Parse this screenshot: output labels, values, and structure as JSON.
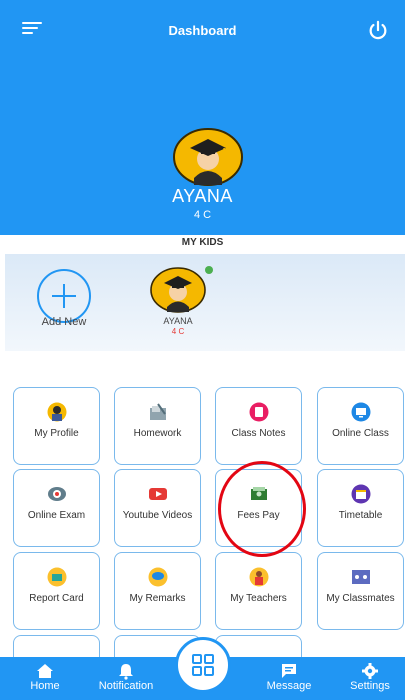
{
  "header": {
    "title": "Dashboard",
    "menu_icon": "menu-icon",
    "power_icon": "power-icon"
  },
  "current_kid": {
    "name": "AYANA",
    "class": "4 C"
  },
  "my_kids_label": "MY KIDS",
  "kids_panel": {
    "add_new_label": "Add New",
    "kids": [
      {
        "name": "AYANA",
        "class": "4 C",
        "online": true
      }
    ]
  },
  "tiles": [
    {
      "label": "My Profile",
      "icon": "profile-icon"
    },
    {
      "label": "Homework",
      "icon": "homework-icon"
    },
    {
      "label": "Class Notes",
      "icon": "class-notes-icon"
    },
    {
      "label": "Online Class",
      "icon": "online-class-icon"
    },
    {
      "label": "Online Exam",
      "icon": "online-exam-icon"
    },
    {
      "label": "Youtube Videos",
      "icon": "youtube-icon"
    },
    {
      "label": "Fees Pay",
      "icon": "fees-pay-icon",
      "highlighted": true
    },
    {
      "label": "Timetable",
      "icon": "timetable-icon"
    },
    {
      "label": "Report Card",
      "icon": "report-card-icon"
    },
    {
      "label": "My Remarks",
      "icon": "remarks-icon"
    },
    {
      "label": "My Teachers",
      "icon": "teachers-icon"
    },
    {
      "label": "My Classmates",
      "icon": "classmates-icon"
    }
  ],
  "bottom_nav": {
    "home": "Home",
    "notification": "Notification",
    "message": "Message",
    "settings": "Settings",
    "center_icon": "grid-icon"
  },
  "colors": {
    "primary": "#2196f3",
    "highlight": "#e30613",
    "online": "#4caf50",
    "class_text": "#e53935"
  }
}
